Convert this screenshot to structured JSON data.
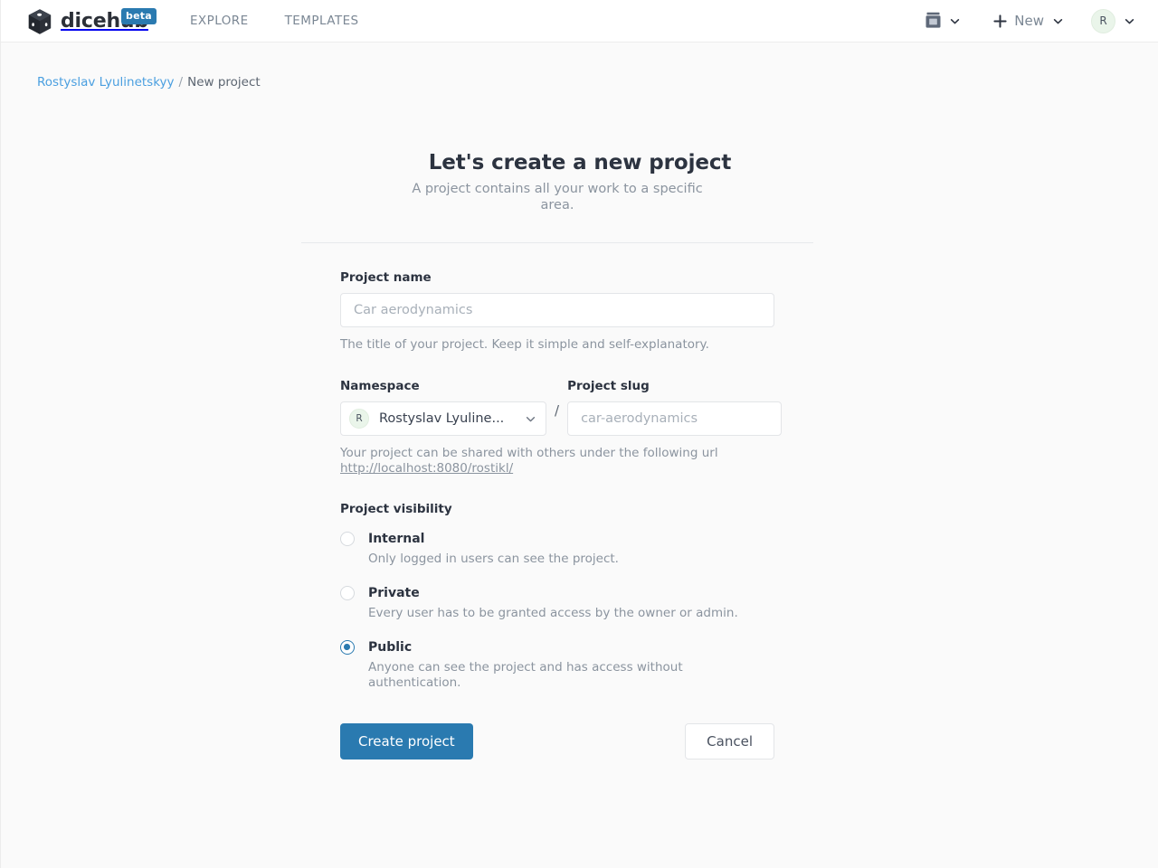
{
  "navbar": {
    "brand_name": "dicehub",
    "brand_icon": "dice-cube-icon",
    "beta_label": "beta",
    "links": [
      {
        "label": "EXPLORE",
        "name": "nav-link-explore"
      },
      {
        "label": "TEMPLATES",
        "name": "nav-link-templates"
      }
    ],
    "docs_icon": "book-icon",
    "new_label": "New",
    "new_icon": "plus-icon",
    "chevron_icon": "chevron-down-icon",
    "avatar_initial": "R"
  },
  "breadcrumb": {
    "owner": "Rostyslav Lyulinetskyy",
    "separator": "/",
    "current": "New project"
  },
  "main": {
    "headline": "Let's create a new project",
    "subheadline": "A project contains all your work to a specific area."
  },
  "form": {
    "project_name": {
      "label": "Project name",
      "value": "",
      "placeholder": "Car aerodynamics",
      "help": "The title of your project. Keep it simple and self-explanatory."
    },
    "namespace": {
      "label": "Namespace",
      "avatar_initial": "R",
      "selected": "Rostyslav Lyuline...",
      "chevron_icon": "chevron-down-icon"
    },
    "slash": "/",
    "project_slug": {
      "label": "Project slug",
      "value": "",
      "placeholder": "car-aerodynamics"
    },
    "url_help": {
      "text": "Your project can be shared with others under the following url",
      "url": "http://localhost:8080/rostikl/"
    },
    "visibility": {
      "label": "Project visibility",
      "selected": "Public",
      "options": [
        {
          "value": "Internal",
          "label": "Internal",
          "description": "Only logged in users can see the project.",
          "checked": false
        },
        {
          "value": "Private",
          "label": "Private",
          "description": "Every user has to be granted access by the owner or admin.",
          "checked": false
        },
        {
          "value": "Public",
          "label": "Public",
          "description": "Anyone can see the project and has access without authentication.",
          "checked": true
        }
      ]
    },
    "actions": {
      "submit_label": "Create project",
      "cancel_label": "Cancel"
    }
  },
  "colors": {
    "accent": "#2a7ab0",
    "link": "#4a9fe0",
    "page_bg": "#fafafa",
    "navbar_bg": "#ffffff",
    "muted_text": "#8b949f",
    "heading_text": "#2c3340",
    "avatar_bg": "#eaf5ea"
  }
}
